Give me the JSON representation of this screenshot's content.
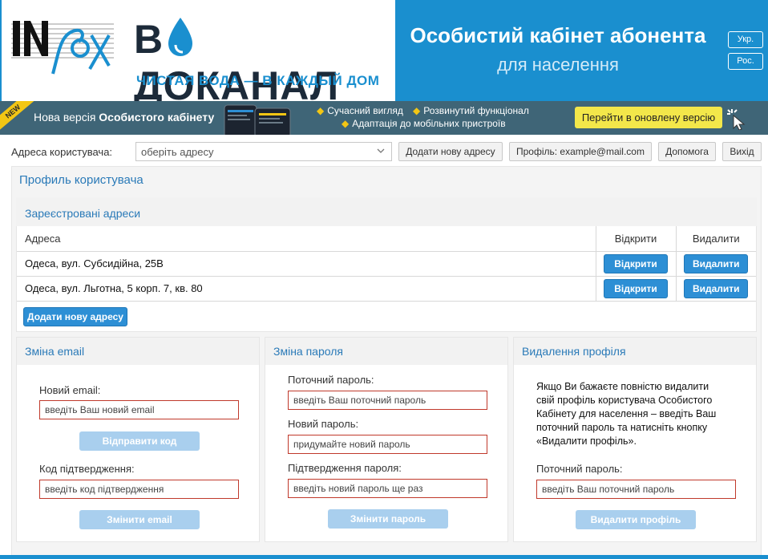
{
  "header": {
    "logo_mark": "INFOX",
    "brand_before": "В",
    "brand_after": "ДОКАНАЛ",
    "slogan": "ЧИСТАЯ ВОДА — В КАЖДЫЙ ДОМ",
    "cabinet_title": "Особистий кабінет абонента",
    "cabinet_subtitle": "для населення",
    "lang_ukr": "Укр.",
    "lang_rus": "Рос."
  },
  "promo": {
    "ribbon": "NEW",
    "text_prefix": "Нова версія ",
    "text_bold": "Особистого кабінету",
    "features": [
      "Сучасний вигляд",
      "Розвинутий функціонал",
      "Адаптація до мобільних пристроїв"
    ],
    "upgrade_label": "Перейти в оновлену версію",
    "colors": {
      "banner": "#3f6577",
      "accent": "#f3e74a"
    }
  },
  "toolbar": {
    "address_label": "Адреса користувача:",
    "address_select_value": "оберіть адресу",
    "add_address_label": "Додати нову адресу",
    "profile_label": "Профіль: example@mail.com",
    "help_label": "Допомога",
    "exit_label": "Вихід"
  },
  "profile": {
    "title": "Профиль користувача",
    "addresses": {
      "title": "Зареєстровані адреси",
      "columns": [
        "Адреса",
        "Відкрити",
        "Видалити"
      ],
      "rows": [
        {
          "address": "Одеса, вул. Субсидійна, 25В",
          "open_label": "Відкрити",
          "delete_label": "Видалити"
        },
        {
          "address": "Одеса, вул. Льготна, 5 корп. 7, кв. 80",
          "open_label": "Відкрити",
          "delete_label": "Видалити"
        }
      ],
      "add_label": "Додати нову адресу"
    },
    "email": {
      "title": "Зміна email",
      "new_label": "Новий email:",
      "new_placeholder": "введіть Ваш новий email",
      "send_label": "Відправити код",
      "code_label": "Код підтвердження:",
      "code_placeholder": "введіть код підтвердження",
      "submit_label": "Змінити email"
    },
    "password": {
      "title": "Зміна пароля",
      "current_label": "Поточний пароль:",
      "current_placeholder": "введіть Ваш поточний пароль",
      "new_label": "Новий пароль:",
      "new_placeholder": "придумайте новий пароль",
      "confirm_label": "Підтвердження пароля:",
      "confirm_placeholder": "введіть новий пароль ще раз",
      "submit_label": "Змінити пароль"
    },
    "delete": {
      "title": "Видалення профіля",
      "text": "Якщо Ви бажаєте повністю видалити свій профіль користувача Особистого Кабінету для населення – введіть Ваш поточний пароль та натисніть кнопку «Видалити профіль».",
      "current_label": "Поточний пароль:",
      "current_placeholder": "введіть Ваш поточний пароль",
      "submit_label": "Видалити профіль"
    }
  },
  "colors": {
    "brand_blue": "#1a8fcf",
    "link_blue": "#2a7ab8",
    "button_blue": "#2d8fd5",
    "disabled_blue": "#a9cfee",
    "input_border": "#c0392b"
  }
}
